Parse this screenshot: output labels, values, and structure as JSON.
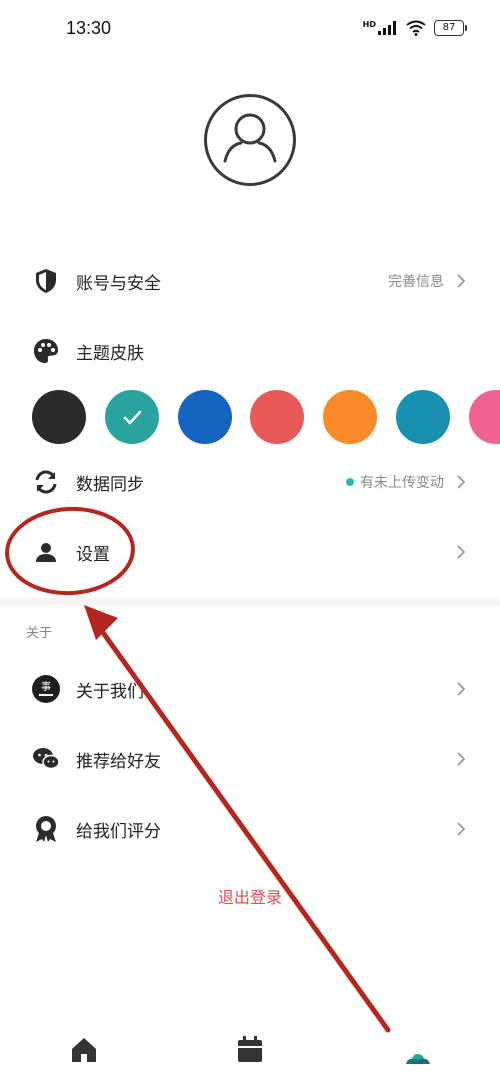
{
  "status": {
    "time": "13:30",
    "battery": "87",
    "network_label": "HD"
  },
  "profile": {
    "avatar_icon": "user-avatar-icon"
  },
  "menu": {
    "account": {
      "label": "账号与安全",
      "right_text": "完善信息",
      "icon": "shield-icon"
    },
    "theme": {
      "label": "主题皮肤",
      "icon": "palette-icon"
    },
    "sync": {
      "label": "数据同步",
      "right_text": "有未上传变动",
      "icon": "sync-icon"
    },
    "settings": {
      "label": "设置",
      "icon": "person-icon"
    }
  },
  "theme_colors": [
    "#2b2b2d",
    "#2aa39f",
    "#1565c0",
    "#e85a57",
    "#f88a2a",
    "#1a90b0",
    "#f06292"
  ],
  "theme_selected_index": 1,
  "about": {
    "title": "关于",
    "items": [
      {
        "label": "关于我们",
        "icon": "brand-logo-icon"
      },
      {
        "label": "推荐给好友",
        "icon": "wechat-icon"
      },
      {
        "label": "给我们评分",
        "icon": "badge-icon"
      }
    ]
  },
  "logout_label": "退出登录",
  "tabs": [
    {
      "name": "home",
      "icon": "home-icon"
    },
    {
      "name": "calendar",
      "icon": "calendar-icon"
    },
    {
      "name": "profile",
      "icon": "profile-icon"
    }
  ],
  "colors": {
    "accent": "#2ab7b1",
    "logout": "#e04e4e",
    "annotation": "#b5261e"
  }
}
